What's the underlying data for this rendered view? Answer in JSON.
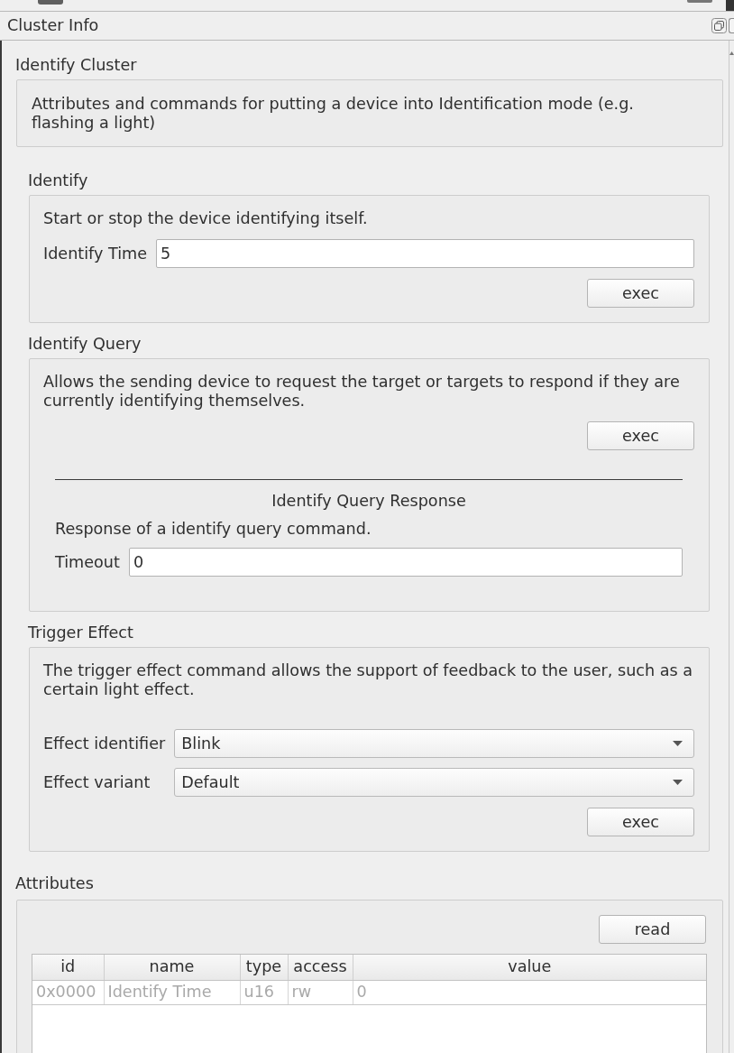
{
  "dock": {
    "title": "Cluster Info"
  },
  "cluster": {
    "title": "Identify Cluster",
    "description": "Attributes and commands for putting a device into Identification mode (e.g. flashing a light)"
  },
  "commands": [
    {
      "title": "Identify",
      "description": "Start or stop the device identifying itself.",
      "fields": [
        {
          "kind": "input",
          "label": "Identify Time",
          "value": "5"
        }
      ],
      "button": "exec"
    },
    {
      "title": "Identify Query",
      "description": "Allows the sending device to request the target or targets to respond if they are currently identifying themselves.",
      "button": "exec",
      "response": {
        "title": "Identify Query Response",
        "description": "Response of a identify query command.",
        "fields": [
          {
            "kind": "input",
            "label": "Timeout",
            "value": "0"
          }
        ]
      }
    },
    {
      "title": "Trigger Effect",
      "description": "The trigger effect command allows the support of feedback to the user, such as a certain light effect.",
      "fields": [
        {
          "kind": "dropdown",
          "label": "Effect identifier",
          "value": "Blink"
        },
        {
          "kind": "dropdown",
          "label": "Effect variant",
          "value": "Default"
        }
      ],
      "button": "exec"
    }
  ],
  "attributes": {
    "title": "Attributes",
    "button": "read",
    "table": {
      "columns": [
        "id",
        "name",
        "type",
        "access",
        "value"
      ],
      "rows": [
        {
          "cells": [
            "0x0000",
            "Identify Time",
            "u16",
            "rw",
            "0"
          ],
          "disabled": true
        }
      ]
    }
  }
}
